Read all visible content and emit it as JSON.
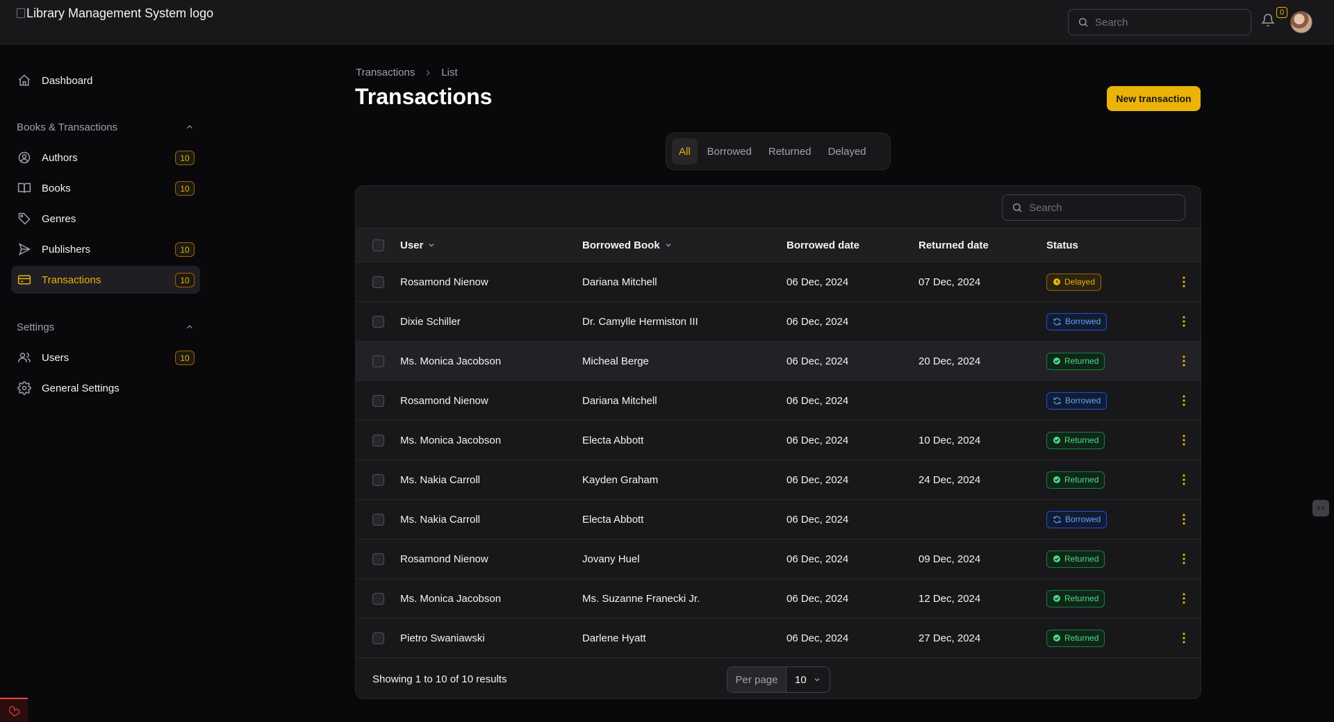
{
  "header": {
    "logo_alt": "Library Management System logo",
    "search_placeholder": "Search",
    "notification_count": "0",
    "icons": [
      "search-icon",
      "bell-icon",
      "avatar"
    ]
  },
  "sidebar": {
    "dashboard": {
      "label": "Dashboard",
      "icon": "home-icon"
    },
    "groups": [
      {
        "label": "Books & Transactions",
        "collapse_icon": "chevron-up-icon",
        "items": [
          {
            "label": "Authors",
            "count": "10",
            "icon": "user-circle-icon"
          },
          {
            "label": "Books",
            "count": "10",
            "icon": "book-open-icon"
          },
          {
            "label": "Genres",
            "count": "",
            "icon": "tag-icon"
          },
          {
            "label": "Publishers",
            "count": "10",
            "icon": "send-icon"
          },
          {
            "label": "Transactions",
            "count": "10",
            "icon": "credit-card-icon",
            "active": true
          }
        ]
      },
      {
        "label": "Settings",
        "collapse_icon": "chevron-up-icon",
        "items": [
          {
            "label": "Users",
            "count": "10",
            "icon": "users-icon"
          },
          {
            "label": "General Settings",
            "count": "",
            "icon": "gear-icon"
          }
        ]
      }
    ]
  },
  "main": {
    "breadcrumb": {
      "parent": "Transactions",
      "current": "List"
    },
    "title": "Transactions",
    "new_button": "New transaction",
    "tabs": [
      {
        "label": "All",
        "active": true
      },
      {
        "label": "Borrowed"
      },
      {
        "label": "Returned"
      },
      {
        "label": "Delayed"
      }
    ],
    "table": {
      "search_placeholder": "Search",
      "columns": {
        "user": "User",
        "book": "Borrowed Book",
        "borrowed_date": "Borrowed date",
        "returned_date": "Returned date",
        "status": "Status"
      },
      "rows": [
        {
          "user": "Rosamond Nienow",
          "book": "Dariana Mitchell",
          "borrowed": "06 Dec, 2024",
          "returned": "07 Dec, 2024",
          "status": "Delayed"
        },
        {
          "user": "Dixie Schiller",
          "book": "Dr. Camylle Hermiston III",
          "borrowed": "06 Dec, 2024",
          "returned": "",
          "status": "Borrowed"
        },
        {
          "user": "Ms. Monica Jacobson",
          "book": "Micheal Berge",
          "borrowed": "06 Dec, 2024",
          "returned": "20 Dec, 2024",
          "status": "Returned"
        },
        {
          "user": "Rosamond Nienow",
          "book": "Dariana Mitchell",
          "borrowed": "06 Dec, 2024",
          "returned": "",
          "status": "Borrowed"
        },
        {
          "user": "Ms. Monica Jacobson",
          "book": "Electa Abbott",
          "borrowed": "06 Dec, 2024",
          "returned": "10 Dec, 2024",
          "status": "Returned"
        },
        {
          "user": "Ms. Nakia Carroll",
          "book": "Kayden Graham",
          "borrowed": "06 Dec, 2024",
          "returned": "24 Dec, 2024",
          "status": "Returned"
        },
        {
          "user": "Ms. Nakia Carroll",
          "book": "Electa Abbott",
          "borrowed": "06 Dec, 2024",
          "returned": "",
          "status": "Borrowed"
        },
        {
          "user": "Rosamond Nienow",
          "book": "Jovany Huel",
          "borrowed": "06 Dec, 2024",
          "returned": "09 Dec, 2024",
          "status": "Returned"
        },
        {
          "user": "Ms. Monica Jacobson",
          "book": "Ms. Suzanne Franecki Jr.",
          "borrowed": "06 Dec, 2024",
          "returned": "12 Dec, 2024",
          "status": "Returned"
        },
        {
          "user": "Pietro Swaniawski",
          "book": "Darlene Hyatt",
          "borrowed": "06 Dec, 2024",
          "returned": "27 Dec, 2024",
          "status": "Returned"
        }
      ],
      "footer": {
        "results": "Showing 1 to 10 of 10 results",
        "per_page_label": "Per page",
        "per_page_value": "10"
      }
    }
  },
  "colors": {
    "accent": "#eab308",
    "background": "#09090b",
    "surface": "#18181b",
    "delayed": "#eab308",
    "borrowed": "#60a5fa",
    "returned": "#4ade80"
  }
}
